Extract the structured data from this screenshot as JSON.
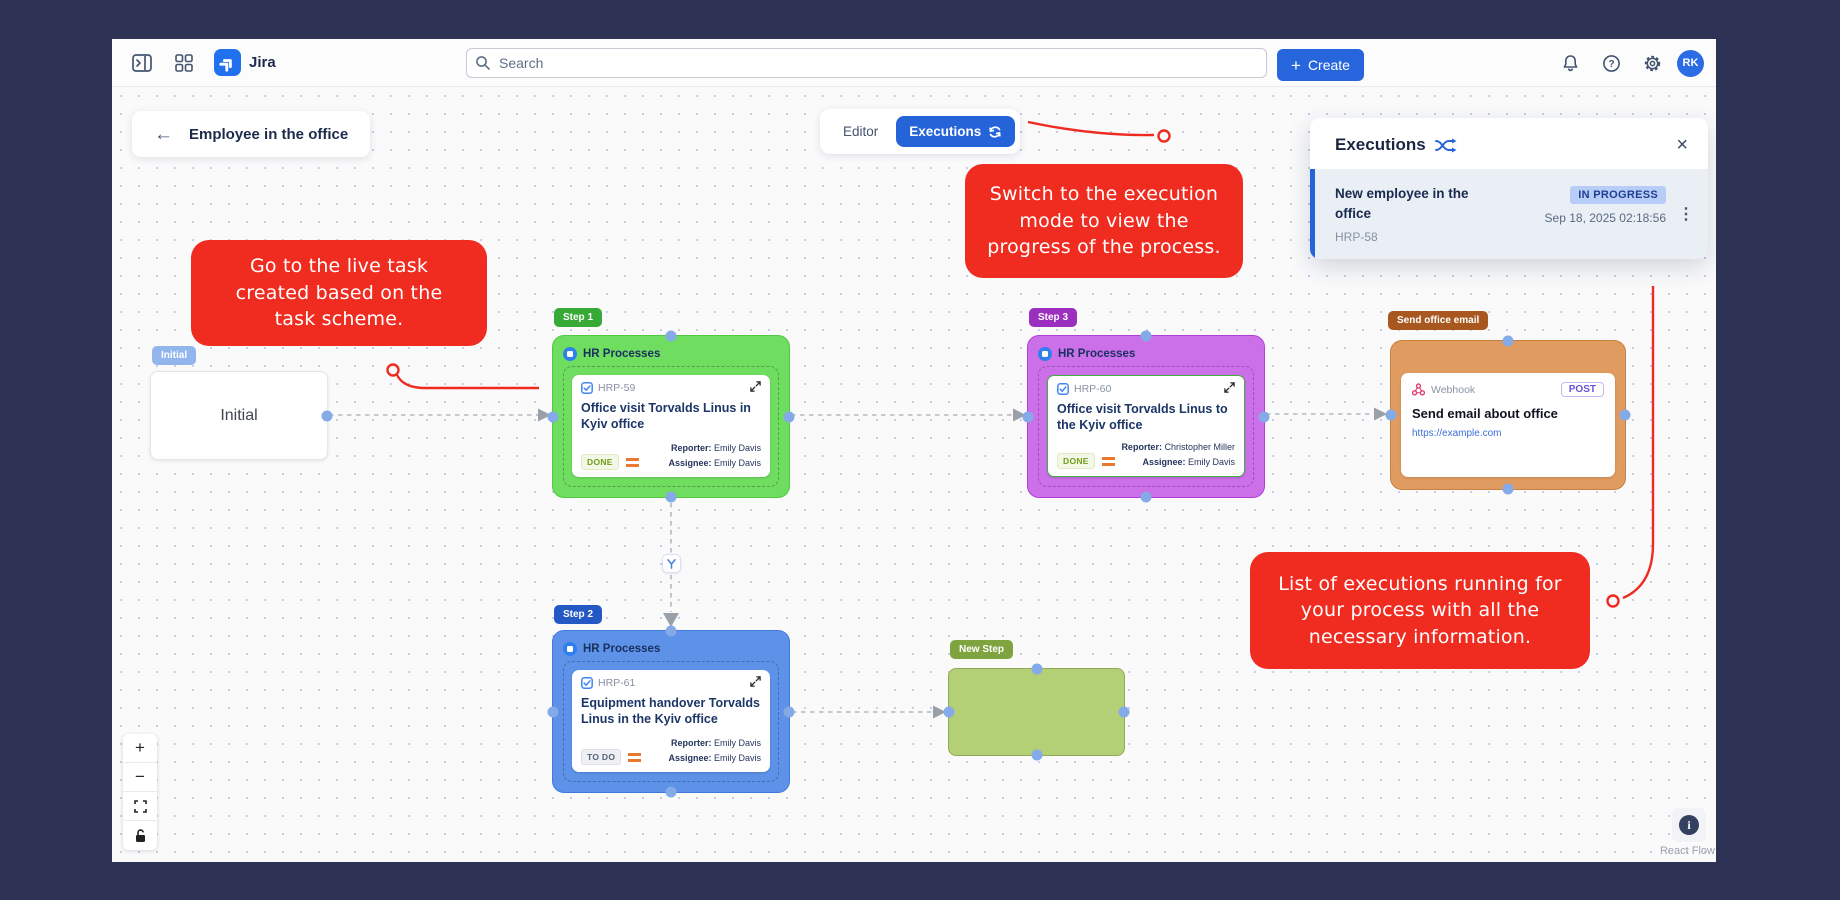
{
  "colors": {
    "frame_navy": "#2e3355",
    "accent_blue": "#2563d9",
    "callout_red": "#f02b20",
    "step1_green": "#6fdd5f",
    "step2_blue": "#5e92e8",
    "step3_purple": "#cb70e9",
    "webhook_orange": "#e09b60",
    "new_step_green": "#b4d077",
    "in_progress_badge_bg": "#b7cdf8"
  },
  "icons": {
    "close": "×",
    "back_arrow": "←",
    "kebab": "⋮",
    "plus": "+",
    "zoom_in": "+",
    "zoom_out": "−",
    "info": "i"
  },
  "navbar": {
    "app_name": "Jira",
    "search_placeholder": "Search",
    "create_label": "Create",
    "avatar_initials": "RK"
  },
  "canvas": {
    "back_button": "Employee in the office",
    "mode_toggle": {
      "editor": "Editor",
      "executions": "Executions"
    },
    "attribution": "React Flow"
  },
  "executions_panel": {
    "title": "Executions",
    "execution": {
      "name": "New employee in the office",
      "key": "HRP-58",
      "status": "IN PROGRESS",
      "timestamp": "Sep 18, 2025 02:18:56"
    }
  },
  "callouts": {
    "live_task": "Go to the live task created based on the task scheme.",
    "execution_mode": "Switch to the execution mode to view the progress of the process.",
    "executions_list": "List of executions running for your process with all the necessary information."
  },
  "labels": {
    "reporter": "Reporter:",
    "assignee": "Assignee:"
  },
  "flow": {
    "initial": {
      "badge": "Initial",
      "title": "Initial"
    },
    "step1": {
      "badge": "Step 1",
      "app": "HR Processes",
      "key": "HRP-59",
      "title": "Office visit Torvalds Linus in Kyiv office",
      "status": "DONE",
      "reporter": "Emily Davis",
      "assignee": "Emily Davis"
    },
    "step2": {
      "badge": "Step 2",
      "app": "HR Processes",
      "key": "HRP-61",
      "title": "Equipment handover Torvalds Linus in the Kyiv office",
      "status": "TO DO",
      "reporter": "Emily Davis",
      "assignee": "Emily Davis"
    },
    "step3": {
      "badge": "Step 3",
      "app": "HR Processes",
      "key": "HRP-60",
      "title": "Office visit Torvalds Linus to the Kyiv office",
      "status": "DONE",
      "reporter": "Christopher Miller",
      "assignee": "Emily Davis"
    },
    "webhook": {
      "badge": "Send office email",
      "type": "Webhook",
      "method": "POST",
      "title": "Send email about office",
      "url": "https://example.com"
    },
    "new_step": {
      "badge": "New Step"
    }
  }
}
